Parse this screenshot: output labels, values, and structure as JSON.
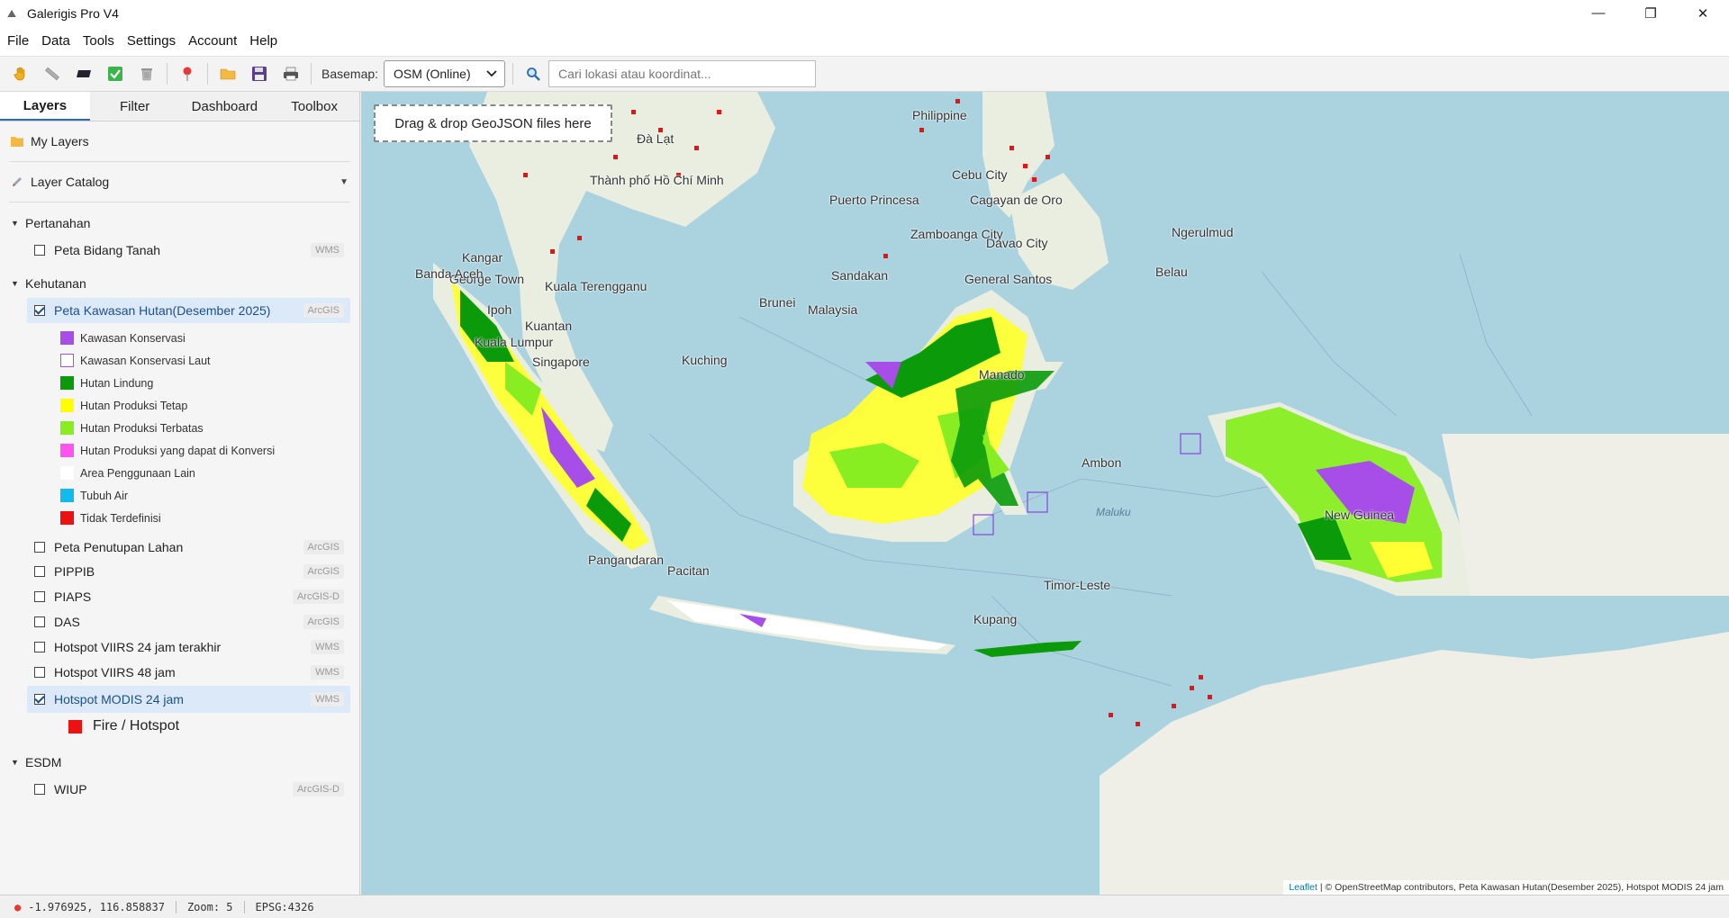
{
  "window": {
    "title": "Galerigis Pro V4"
  },
  "menu": [
    "File",
    "Data",
    "Tools",
    "Settings",
    "Account",
    "Help"
  ],
  "toolbar": {
    "basemap_label": "Basemap:",
    "basemap_value": "OSM (Online)",
    "search_placeholder": "Cari lokasi atau koordinat..."
  },
  "tabs": [
    "Layers",
    "Filter",
    "Dashboard",
    "Toolbox"
  ],
  "panel": {
    "my_layers": "My Layers",
    "layer_catalog": "Layer Catalog",
    "groups": {
      "pertanahan": {
        "label": "Pertanahan",
        "layers": [
          {
            "name": "Peta Bidang Tanah",
            "type": "WMS",
            "checked": false
          }
        ]
      },
      "kehutanan": {
        "label": "Kehutanan",
        "kawasan": {
          "name": "Peta Kawasan Hutan(Desember 2025)",
          "type": "ArcGIS",
          "checked": true
        },
        "legend": [
          {
            "label": "Kawasan Konservasi",
            "color": "#a84ee8"
          },
          {
            "label": "Kawasan Konservasi Laut",
            "color": "#ffffff",
            "border": "#a84ee8"
          },
          {
            "label": "Hutan Lindung",
            "color": "#0a9a0a"
          },
          {
            "label": "Hutan Produksi Tetap",
            "color": "#ffff00"
          },
          {
            "label": "Hutan Produksi Terbatas",
            "color": "#88ee22"
          },
          {
            "label": "Hutan Produksi yang dapat di Konversi",
            "color": "#ff55ee"
          },
          {
            "label": "Area Penggunaan Lain",
            "color": "#ffffff"
          },
          {
            "label": "Tubuh Air",
            "color": "#11bbee"
          },
          {
            "label": "Tidak Terdefinisi",
            "color": "#ee1111"
          }
        ],
        "layers": [
          {
            "name": "Peta Penutupan Lahan",
            "type": "ArcGIS"
          },
          {
            "name": "PIPPIB",
            "type": "ArcGIS"
          },
          {
            "name": "PIAPS",
            "type": "ArcGIS-D"
          },
          {
            "name": "DAS",
            "type": "ArcGIS"
          },
          {
            "name": "Hotspot VIIRS 24 jam terakhir",
            "type": "WMS"
          },
          {
            "name": "Hotspot VIIRS 48 jam",
            "type": "WMS"
          }
        ],
        "modis": {
          "name": "Hotspot MODIS 24 jam",
          "type": "WMS",
          "checked": true
        },
        "fire_legend": "Fire / Hotspot"
      },
      "esdm": {
        "label": "ESDM",
        "layers": [
          {
            "name": "WIUP",
            "type": "ArcGIS-D",
            "checked": false
          }
        ]
      }
    }
  },
  "map": {
    "dropzone": "Drag & drop GeoJSON files here",
    "attribution_leaflet": "Leaflet",
    "attribution_rest": " | © OpenStreetMap contributors, Peta Kawasan Hutan(Desember 2025), Hotspot MODIS 24 jam",
    "labels": {
      "philippines": "Philippine",
      "cebu": "Cebu City",
      "cagayan": "Cagayan\nde Oro",
      "puerto": "Puerto Princesa",
      "zamboanga": "Zamboanga\nCity",
      "davao": "Davao City",
      "ngerulmud": "Ngerulmud",
      "belau": "Belau",
      "generalsantos": "General Santos",
      "dalat": "Đà Lạt",
      "thanhpho": "Thành phố\nHồ Chí Minh",
      "kangar": "Kangar",
      "georgetown": "George Town",
      "kualatrengganu": "Kuala Terengganu",
      "ipoh": "Ipoh",
      "kuantan": "Kuantan",
      "kualalumpur": "Kuala Lumpur",
      "singapore": "Singapore",
      "bandaaceh": "Banda Aceh",
      "brunei": "Brunei",
      "sandakan": "Sandakan",
      "malaysia": "Malaysia",
      "kuching": "Kuching",
      "manado": "Manado",
      "ambon": "Ambon",
      "kupang": "Kupang",
      "timorleste": "Timor-Leste",
      "newguinea": "New Guinea",
      "pangandaran": "Pangandaran",
      "pacitan": "Pacitan",
      "maluku": "Maluku"
    }
  },
  "status": {
    "coords": "-1.976925, 116.858837",
    "zoom": "Zoom: 5",
    "epsg": "EPSG:4326"
  }
}
